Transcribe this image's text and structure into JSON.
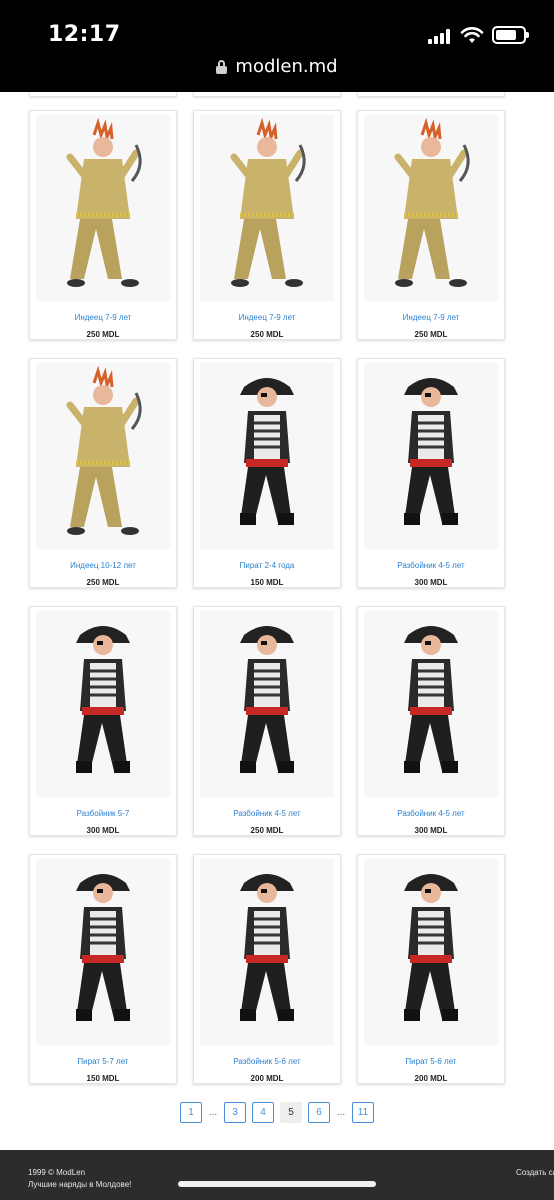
{
  "status_bar": {
    "time": "12:17",
    "battery_level": 0.78
  },
  "browser": {
    "url": "modlen.md"
  },
  "products": [
    {
      "title": "Индеец 7-9 лет",
      "price": "250 MDL",
      "icon": "indian-costume"
    },
    {
      "title": "Индеец 7-9 лет",
      "price": "250 MDL",
      "icon": "indian-costume"
    },
    {
      "title": "Индеец 7-9 лет",
      "price": "250 MDL",
      "icon": "indian-costume"
    },
    {
      "title": "Индеец 10-12 лет",
      "price": "250 MDL",
      "icon": "indian-costume"
    },
    {
      "title": "Пират 2-4 года",
      "price": "150 MDL",
      "icon": "pirate-costume"
    },
    {
      "title": "Разбойник 4-5 лет",
      "price": "300 MDL",
      "icon": "pirate-costume"
    },
    {
      "title": "Разбойник 5-7",
      "price": "300 MDL",
      "icon": "pirate-costume"
    },
    {
      "title": "Разбойник 4-5 лет",
      "price": "250 MDL",
      "icon": "pirate-costume"
    },
    {
      "title": "Разбойник 4-5 лет",
      "price": "300 MDL",
      "icon": "pirate-costume"
    },
    {
      "title": "Пират 5-7 лет",
      "price": "150 MDL",
      "icon": "pirate-costume"
    },
    {
      "title": "Разбойник 5-6 лет",
      "price": "200 MDL",
      "icon": "pirate-costume"
    },
    {
      "title": "Пират 5-6 лет",
      "price": "200 MDL",
      "icon": "pirate-costume"
    }
  ],
  "pagination": {
    "pages": [
      "1",
      "...",
      "3",
      "4",
      "5",
      "6",
      "...",
      "11"
    ],
    "current": "5"
  },
  "footer": {
    "copyright": "1999 © ModLen",
    "tagline": "Лучшие наряды в Молдове!",
    "right_text": "Создать са"
  },
  "colors": {
    "link": "#2b7fcf",
    "page_border": "#4a90d9",
    "footer_bg": "#2c2c2c"
  }
}
